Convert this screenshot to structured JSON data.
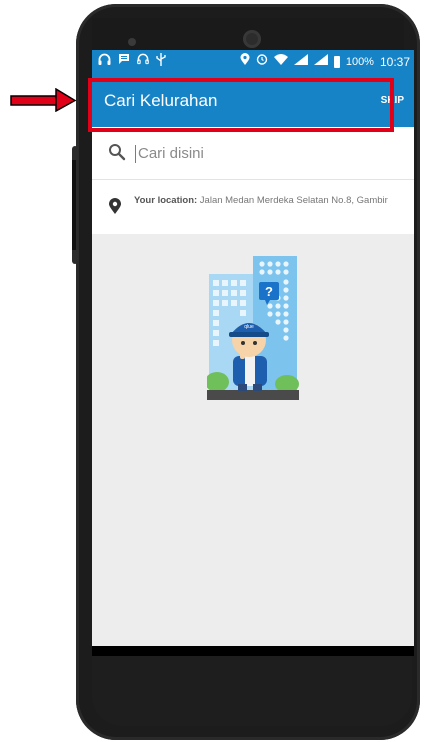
{
  "status_bar": {
    "battery_percent": "100%",
    "time": "10:37",
    "icons": [
      "headset-icon",
      "message-icon",
      "headset-icon",
      "usb-icon",
      "location-icon",
      "alarm-icon",
      "wifi-icon",
      "signal-icon",
      "signal-icon",
      "battery-icon"
    ]
  },
  "app_bar": {
    "title": "Cari Kelurahan",
    "action_label": "SKIP"
  },
  "search": {
    "placeholder": "Cari disini",
    "value": ""
  },
  "location": {
    "label": "Your location:",
    "address": "Jalan Medan Merdeka Selatan No.8, Gambir"
  },
  "colors": {
    "primary": "#1683c7",
    "highlight": "#e00018",
    "caret": "#e5428b"
  }
}
